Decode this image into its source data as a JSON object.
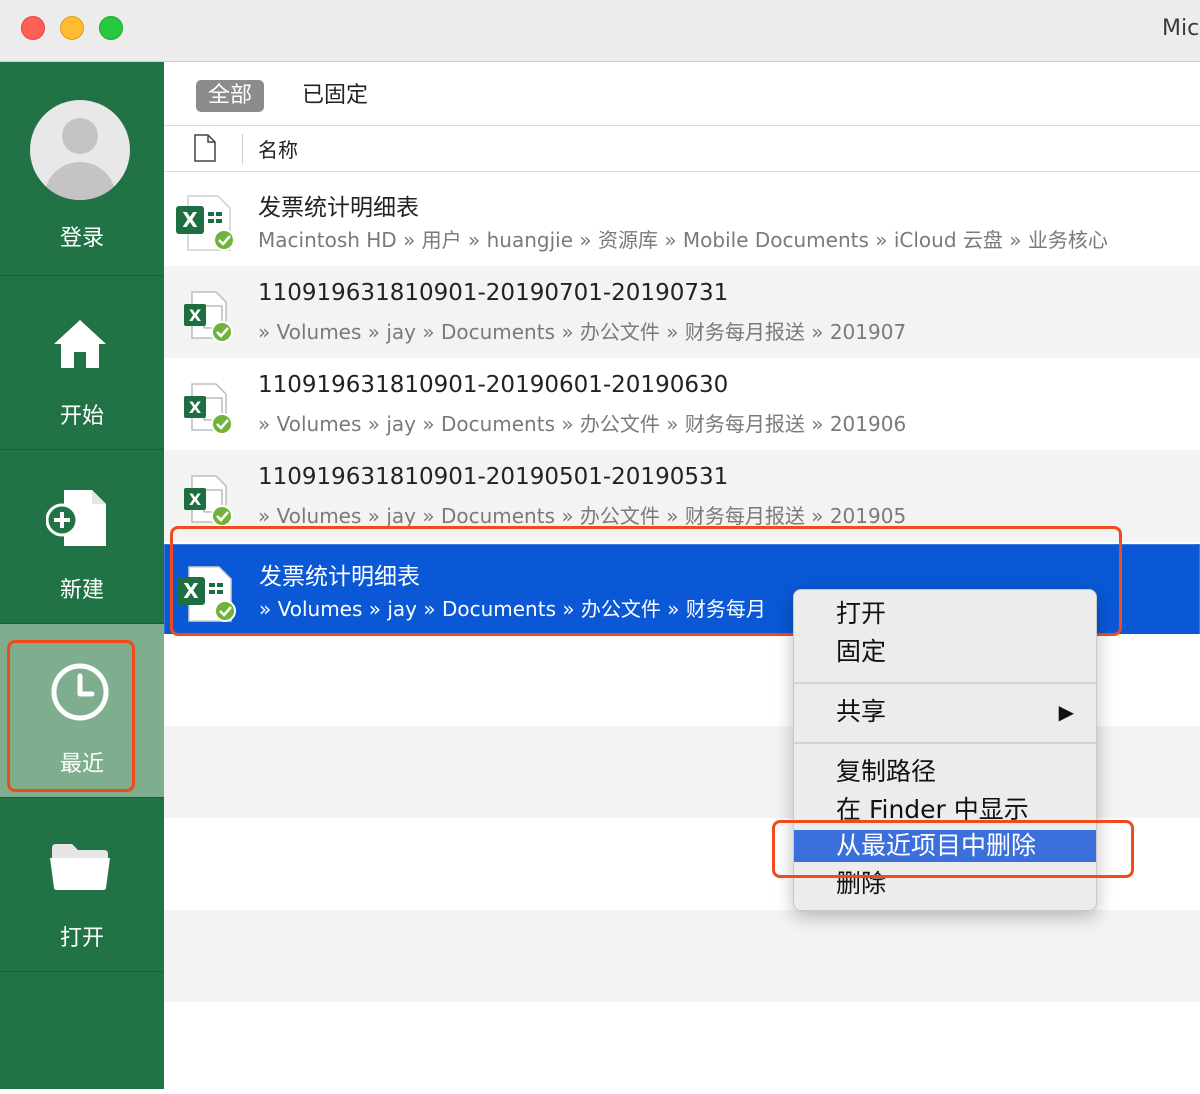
{
  "window": {
    "title": "Mic"
  },
  "sidebar": {
    "signin": "登录",
    "items": [
      {
        "label": "开始",
        "icon": "home-icon"
      },
      {
        "label": "新建",
        "icon": "new-document-icon"
      },
      {
        "label": "最近",
        "icon": "clock-icon",
        "active": true
      },
      {
        "label": "打开",
        "icon": "folder-icon"
      }
    ],
    "colors": {
      "green": "#217346",
      "active": "#7fae8e"
    }
  },
  "tabs": {
    "all": "全部",
    "pinned": "已固定"
  },
  "table": {
    "name_header": "名称"
  },
  "files": [
    {
      "name": "发票统计明细表",
      "path": "Macintosh HD » 用户 » huangjie » 资源库 » Mobile Documents » iCloud 云盘 » 业务核心"
    },
    {
      "name": "110919631810901-20190701-20190731",
      "path": " » Volumes » jay » Documents » 办公文件 » 财务每月报送 » 201907"
    },
    {
      "name": "110919631810901-20190601-20190630",
      "path": " » Volumes » jay » Documents » 办公文件 » 财务每月报送 » 201906"
    },
    {
      "name": "110919631810901-20190501-20190531",
      "path": " » Volumes » jay » Documents » 办公文件 » 财务每月报送 » 201905"
    },
    {
      "name": "发票统计明细表",
      "path": " » Volumes » jay » Documents » 办公文件 » 财务每月",
      "selected": true
    }
  ],
  "context_menu": {
    "open": "打开",
    "pin": "固定",
    "share": "共享",
    "share_arrow": "▶",
    "copy_path": "复制路径",
    "show_in_finder": "在 Finder 中显示",
    "remove_from_recent": "从最近项目中删除",
    "delete": "删除"
  },
  "colors": {
    "selection": "#0a58d5",
    "highlight_box": "#f04a1d",
    "menu_highlight": "#3b6fdc"
  }
}
